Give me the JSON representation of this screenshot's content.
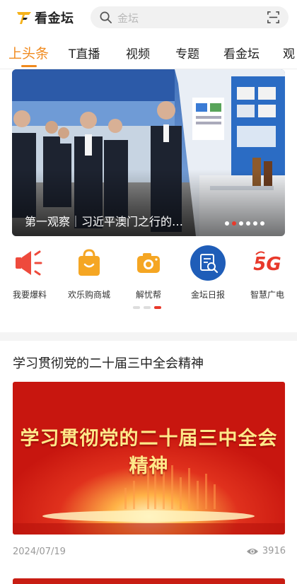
{
  "header": {
    "logo_text": "看金坛",
    "search_placeholder": "金坛",
    "icons": [
      "logo-icon",
      "search-icon",
      "scan-icon"
    ]
  },
  "tabs": [
    {
      "label": "上头条",
      "active": true
    },
    {
      "label": "T直播",
      "active": false
    },
    {
      "label": "视频",
      "active": false
    },
    {
      "label": "专题",
      "active": false
    },
    {
      "label": "看金坛",
      "active": false
    },
    {
      "label": "观",
      "active": false
    }
  ],
  "banner": {
    "caption": "第一观察｜习近平澳门之行的…",
    "slide_count": 6,
    "active_slide": 1
  },
  "quick_actions": [
    {
      "label": "我要爆料",
      "icon": "megaphone-icon"
    },
    {
      "label": "欢乐购商城",
      "icon": "shopping-bag-icon"
    },
    {
      "label": "解忧帮",
      "icon": "camera-icon"
    },
    {
      "label": "金坛日报",
      "icon": "newspaper-search-icon"
    },
    {
      "label": "智慧广电",
      "icon": "5g-icon"
    }
  ],
  "quick_page_dots": {
    "count": 3,
    "active": 2
  },
  "article": {
    "title": "学习贯彻党的二十届三中全会精神",
    "image_text": "学习贯彻党的二十届三中全会精神",
    "date": "2024/07/19",
    "views": "3916"
  },
  "colors": {
    "accent": "#f08a1e",
    "active_dot": "#e8392b",
    "banner_red": "#c81d13"
  }
}
